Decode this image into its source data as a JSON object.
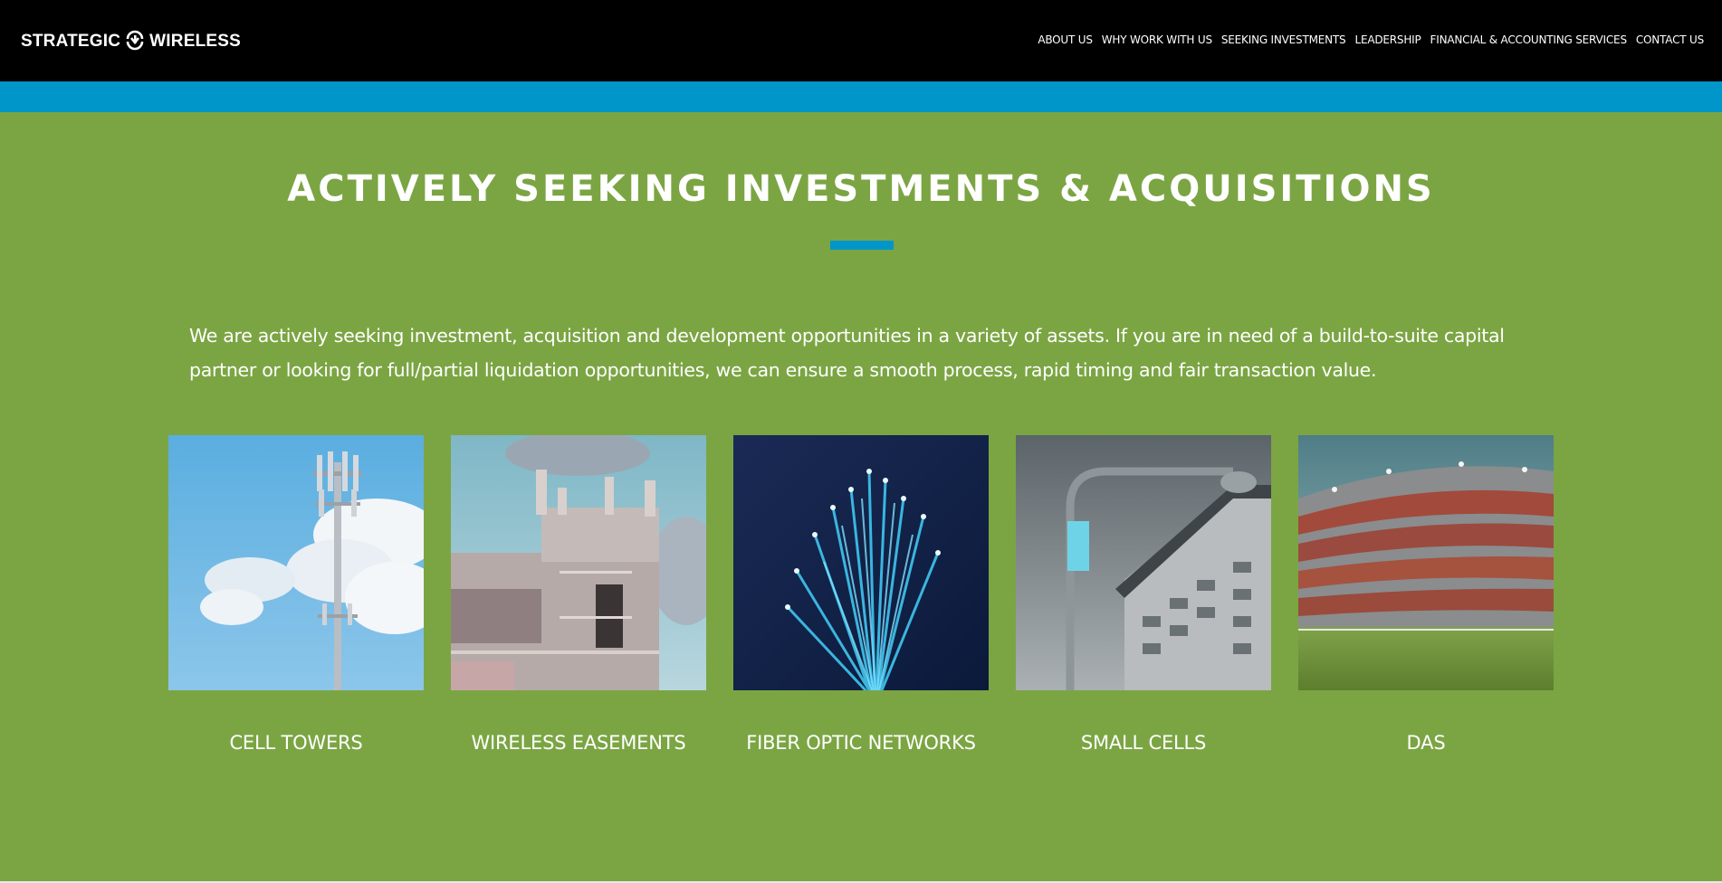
{
  "brand": {
    "name_left": "STRATEGIC",
    "name_right": "WIRELESS"
  },
  "nav": {
    "items": [
      {
        "label": "ABOUT US"
      },
      {
        "label": "WHY WORK WITH US"
      },
      {
        "label": "SEEKING INVESTMENTS"
      },
      {
        "label": "LEADERSHIP"
      },
      {
        "label": "FINANCIAL & ACCOUNTING SERVICES"
      },
      {
        "label": "CONTACT US"
      }
    ]
  },
  "hero": {
    "title": "ACTIVELY SEEKING INVESTMENTS & ACQUISITIONS",
    "intro": "We are actively seeking investment, acquisition and development opportunities in a variety of assets. If you are in need of a build-to-suite capital partner or looking for full/partial liquidation opportunities, we can ensure a smooth process, rapid timing and fair transaction value."
  },
  "assets": [
    {
      "label": "CELL TOWERS",
      "image": "cell-tower-photo"
    },
    {
      "label": "WIRELESS EASEMENTS",
      "image": "rooftop-antennas-photo"
    },
    {
      "label": "FIBER OPTIC NETWORKS",
      "image": "fiber-optic-photo"
    },
    {
      "label": "SMALL CELLS",
      "image": "streetlight-small-cell-photo"
    },
    {
      "label": "DAS",
      "image": "stadium-photo"
    }
  ],
  "colors": {
    "header_bg": "#000000",
    "accent_blue": "#0096c9",
    "section_green": "#7ba543",
    "text": "#ffffff"
  }
}
